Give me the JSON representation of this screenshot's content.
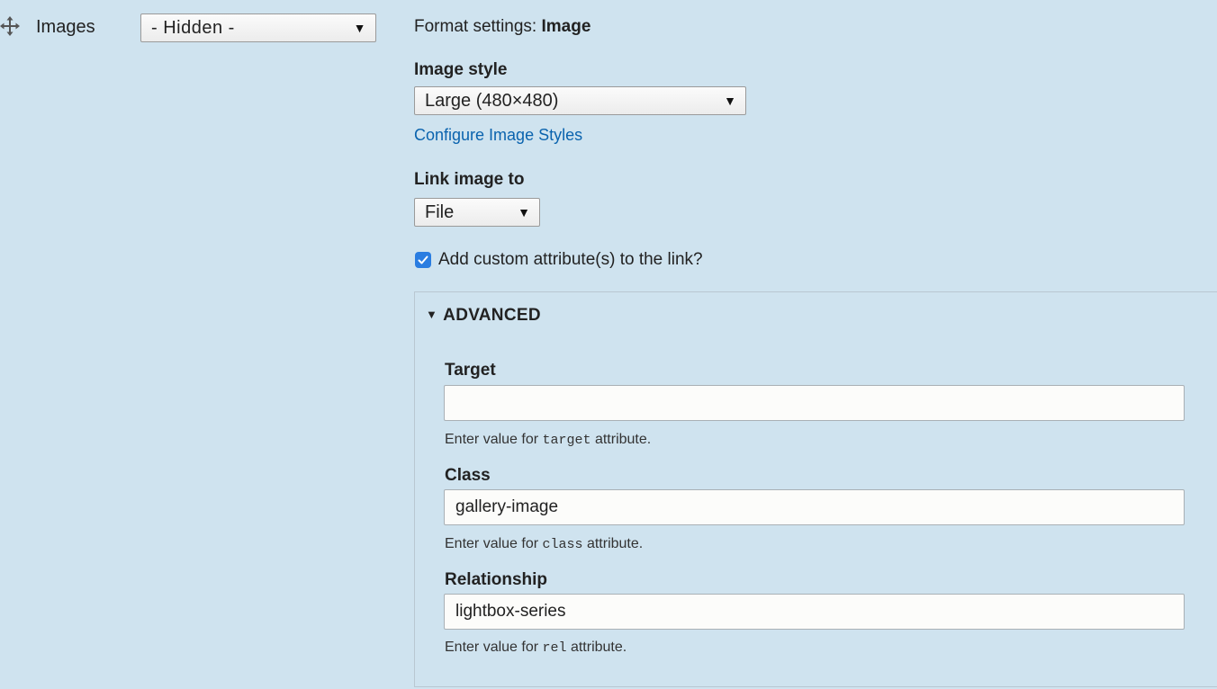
{
  "field_row": {
    "label": "Images",
    "visibility_select": "- Hidden -"
  },
  "format_settings": {
    "prefix": "Format settings: ",
    "formatter": "Image"
  },
  "image_style": {
    "label": "Image style",
    "selected": "Large (480×480)",
    "configure_link": "Configure Image Styles"
  },
  "link_image": {
    "label": "Link image to",
    "selected": "File"
  },
  "custom_attributes": {
    "checked": true,
    "label": "Add custom attribute(s) to the link?"
  },
  "advanced": {
    "summary": "ADVANCED",
    "target": {
      "label": "Target",
      "value": "",
      "desc_before": "Enter value for ",
      "desc_code": "target",
      "desc_after": " attribute."
    },
    "class": {
      "label": "Class",
      "value": "gallery-image",
      "desc_before": "Enter value for ",
      "desc_code": "class",
      "desc_after": " attribute."
    },
    "relationship": {
      "label": "Relationship",
      "value": "lightbox-series",
      "desc_before": "Enter value for ",
      "desc_code": "rel",
      "desc_after": " attribute."
    }
  },
  "colors": {
    "background": "#cfe3ef",
    "link": "#0a63ae",
    "checkbox": "#2a7de1"
  }
}
